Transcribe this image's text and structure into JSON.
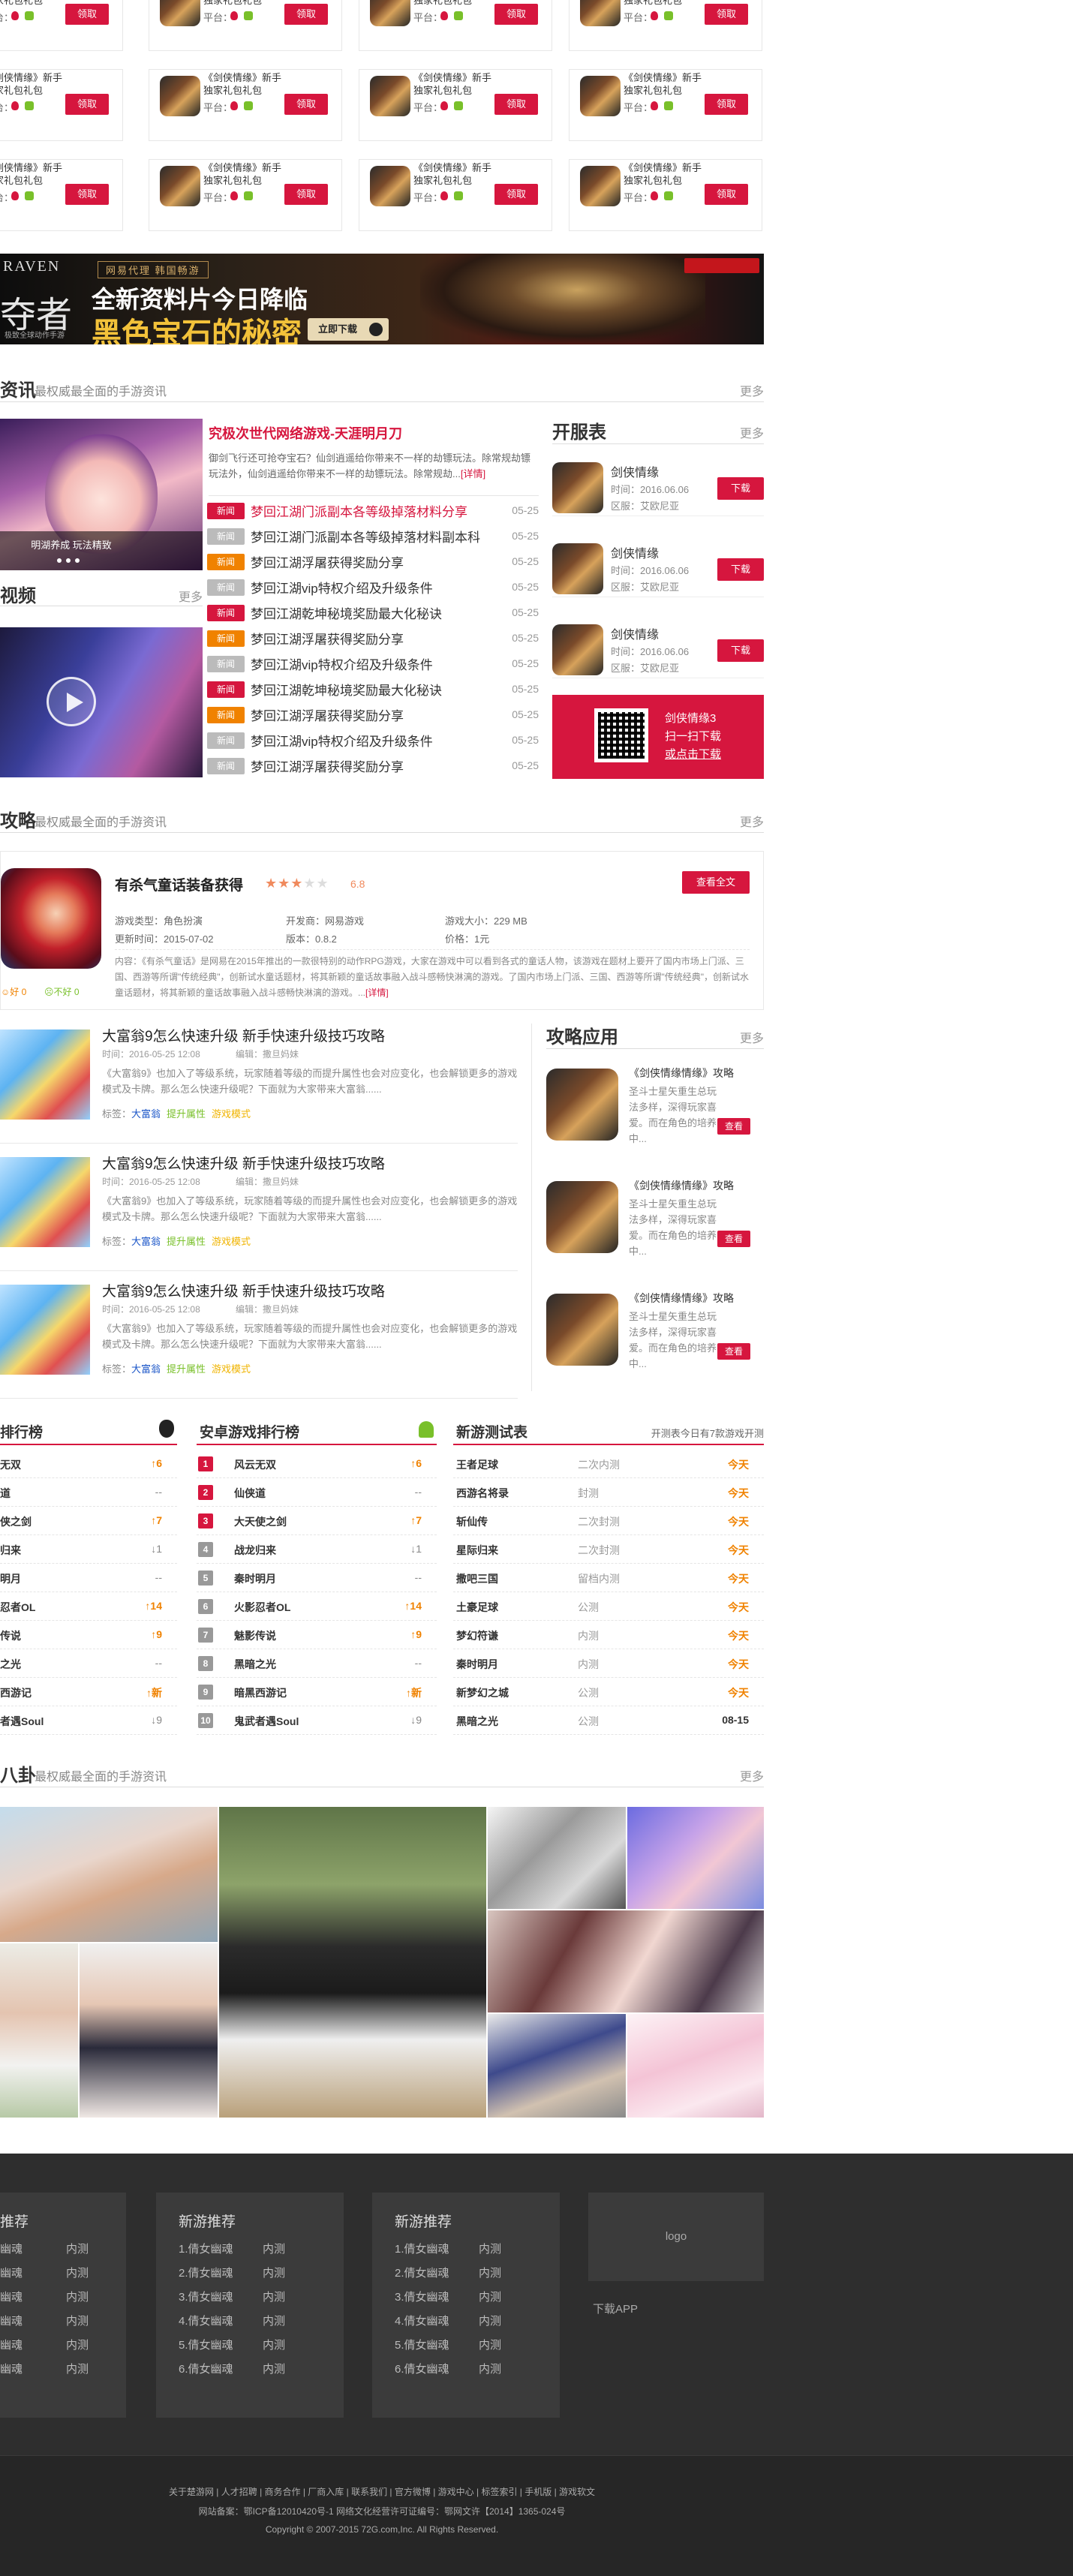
{
  "gift": {
    "title": "《剑侠情缘》新手独家礼包礼包",
    "platform": "平台：",
    "btn": "领取"
  },
  "banner": {
    "brand": "RAVEN",
    "kicker": "网易代理 韩国畅游",
    "left_title": "夺者",
    "left_sub": "极致全球动作手游",
    "headline1": "全新资料片今日降临",
    "headline2": "黑色宝石的秘密",
    "cta": "立即下载"
  },
  "news": {
    "title": "资讯",
    "subtitle": "最权威最全面的手游资讯",
    "more": "更多",
    "image_caption": "明湖养成 玩法精致",
    "headline": "究极次世代网络游戏-天涯明月刀",
    "summary": "御剑飞行还可抢夺宝石？仙剑逍遥给你带来不一样的劫镖玩法。除常规劫镖玩法外，仙剑逍遥给你带来不一样的劫镖玩法。除常规劫...",
    "summary_link": "[详情]",
    "items": [
      {
        "tag": "新闻",
        "title": "梦回江湖门派副本各等级掉落材料分享",
        "date": "05-25"
      },
      {
        "tag": "新闻",
        "title": "梦回江湖门派副本各等级掉落材料副本科",
        "date": "05-25"
      },
      {
        "tag": "新闻",
        "title": "梦回江湖浮屠获得奖励分享",
        "date": "05-25"
      },
      {
        "tag": "新闻",
        "title": "梦回江湖vip特权介绍及升级条件",
        "date": "05-25"
      },
      {
        "tag": "新闻",
        "title": "梦回江湖乾坤秘境奖励最大化秘诀",
        "date": "05-25"
      },
      {
        "tag": "新闻",
        "title": "梦回江湖浮屠获得奖励分享",
        "date": "05-25"
      },
      {
        "tag": "新闻",
        "title": "梦回江湖vip特权介绍及升级条件",
        "date": "05-25"
      },
      {
        "tag": "新闻",
        "title": "梦回江湖乾坤秘境奖励最大化秘诀",
        "date": "05-25"
      },
      {
        "tag": "新闻",
        "title": "梦回江湖浮屠获得奖励分享",
        "date": "05-25"
      },
      {
        "tag": "新闻",
        "title": "梦回江湖vip特权介绍及升级条件",
        "date": "05-25"
      },
      {
        "tag": "新闻",
        "title": "梦回江湖浮屠获得奖励分享",
        "date": "05-25"
      }
    ],
    "tag_colors": [
      "#d6163e",
      "#bbbbbb",
      "#f08200",
      "#bbbbbb",
      "#d6163e",
      "#f08200",
      "#bbbbbb",
      "#d6163e",
      "#f08200",
      "#bbbbbb",
      "#bbbbbb"
    ]
  },
  "video": {
    "title": "视频",
    "more": "更多"
  },
  "server": {
    "title": "开服表",
    "more": "更多",
    "items": [
      {
        "name": "剑侠情缘",
        "time": "时间：2016.06.06",
        "zone": "区服：艾欧尼亚",
        "btn": "下载"
      },
      {
        "name": "剑侠情缘",
        "time": "时间：2016.06.06",
        "zone": "区服：艾欧尼亚",
        "btn": "下载"
      },
      {
        "name": "剑侠情缘",
        "time": "时间：2016.06.06",
        "zone": "区服：艾欧尼亚",
        "btn": "下载"
      }
    ],
    "qr": {
      "line1": "剑侠情缘3",
      "line2": "扫一扫下载",
      "line3": "或点击下载"
    }
  },
  "guide": {
    "title": "攻略",
    "subtitle": "最权威最全面的手游资讯",
    "more": "更多",
    "featured": {
      "name": "有杀气童话装备获得",
      "score": "6.8",
      "btn": "查看全文",
      "type": "游戏类型：角色扮演",
      "dev": "开发商：网易游戏",
      "size": "游戏大小：229 MB",
      "update": "更新时间：2015-07-02",
      "version": "版本：0.8.2",
      "price": "价格：1元",
      "desc": "内容：《有杀气童话》是网易在2015年推出的一款很特别的动作RPG游戏，大家在游戏中可以看到各式的童话人物，该游戏在题材上要开了国内市场上门派、三国、西游等所谓\"传统经典\"，创新试水童话题材，将其新颖的童话故事融入战斗感畅快淋漓的游戏。了国内市场上门派、三国、西游等所谓\"传统经典\"，创新试水童话题材，将其新颖的童话故事融入战斗感畅快淋漓的游戏。...",
      "desc_link": "[详情]",
      "good": "好 0",
      "bad": "不好 0"
    },
    "articles": [
      {
        "title": "大富翁9怎么快速升级 新手快速升级技巧攻略",
        "time": "时间：2016-05-25 12:08",
        "editor": "编辑：撒旦妈妹",
        "summary": "《大富翁9》也加入了等级系统，玩家随着等级的而提升属性也会对应变化，也会解锁更多的游戏模式及卡牌。那么怎么快速升级呢？下面就为大家带来大富翁......",
        "label": "标签：",
        "t1": "大富翁",
        "t2": "提升属性",
        "t3": "游戏模式"
      },
      {
        "title": "大富翁9怎么快速升级 新手快速升级技巧攻略",
        "time": "时间：2016-05-25 12:08",
        "editor": "编辑：撒旦妈妹",
        "summary": "《大富翁9》也加入了等级系统，玩家随着等级的而提升属性也会对应变化，也会解锁更多的游戏模式及卡牌。那么怎么快速升级呢？下面就为大家带来大富翁......",
        "label": "标签：",
        "t1": "大富翁",
        "t2": "提升属性",
        "t3": "游戏模式"
      },
      {
        "title": "大富翁9怎么快速升级 新手快速升级技巧攻略",
        "time": "时间：2016-05-25 12:08",
        "editor": "编辑：撒旦妈妹",
        "summary": "《大富翁9》也加入了等级系统，玩家随着等级的而提升属性也会对应变化，也会解锁更多的游戏模式及卡牌。那么怎么快速升级呢？下面就为大家带来大富翁......",
        "label": "标签：",
        "t1": "大富翁",
        "t2": "提升属性",
        "t3": "游戏模式"
      }
    ],
    "apps_title": "攻略应用",
    "apps_more": "更多",
    "apps": [
      {
        "name": "《剑侠情缘情缘》攻略",
        "desc": "圣斗士星矢重生总玩法多样，深得玩家喜爱。而在角色的培养中...",
        "btn": "查看"
      },
      {
        "name": "《剑侠情缘情缘》攻略",
        "desc": "圣斗士星矢重生总玩法多样，深得玩家喜爱。而在角色的培养中...",
        "btn": "查看"
      },
      {
        "name": "《剑侠情缘情缘》攻略",
        "desc": "圣斗士星矢重生总玩法多样，深得玩家喜爱。而在角色的培养中...",
        "btn": "查看"
      }
    ]
  },
  "ranks": {
    "ios_title": "排行榜",
    "android_title": "安卓游戏排行榜",
    "ios": [
      {
        "name": "无双",
        "change": "↑6"
      },
      {
        "name": "道",
        "change": "--"
      },
      {
        "name": "侠之剑",
        "change": "↑7"
      },
      {
        "name": "归来",
        "change": "↓1"
      },
      {
        "name": "明月",
        "change": "--"
      },
      {
        "name": "忍者OL",
        "change": "↑14"
      },
      {
        "name": "传说",
        "change": "↑9"
      },
      {
        "name": "之光",
        "change": "--"
      },
      {
        "name": "西游记",
        "change": "↑新"
      },
      {
        "name": "者遇Soul",
        "change": "↓9"
      }
    ],
    "android": [
      {
        "num": "1",
        "name": "风云无双",
        "change": "↑6"
      },
      {
        "num": "2",
        "name": "仙侠道",
        "change": "--"
      },
      {
        "num": "3",
        "name": "大天使之剑",
        "change": "↑7"
      },
      {
        "num": "4",
        "name": "战龙归来",
        "change": "↓1"
      },
      {
        "num": "5",
        "name": "秦时明月",
        "change": "--"
      },
      {
        "num": "6",
        "name": "火影忍者OL",
        "change": "↑14"
      },
      {
        "num": "7",
        "name": "魅影传说",
        "change": "↑9"
      },
      {
        "num": "8",
        "name": "黑暗之光",
        "change": "--"
      },
      {
        "num": "9",
        "name": "暗黑西游记",
        "change": "↑新"
      },
      {
        "num": "10",
        "name": "鬼武者遇Soul",
        "change": "↓9"
      }
    ],
    "test_title": "新游测试表",
    "test_note": "开测表今日有7款游戏开测",
    "tests": [
      {
        "name": "王者足球",
        "stage": "二次内测",
        "date": "今天"
      },
      {
        "name": "西游名将录",
        "stage": "封测",
        "date": "今天"
      },
      {
        "name": "斩仙传",
        "stage": "二次封测",
        "date": "今天"
      },
      {
        "name": "星际归来",
        "stage": "二次封测",
        "date": "今天"
      },
      {
        "name": "撒吧三国",
        "stage": "留档内测",
        "date": "今天"
      },
      {
        "name": "土豪足球",
        "stage": "公测",
        "date": "今天"
      },
      {
        "name": "梦幻符谦",
        "stage": "内测",
        "date": "今天"
      },
      {
        "name": "秦时明月",
        "stage": "内测",
        "date": "今天"
      },
      {
        "name": "新梦幻之城",
        "stage": "公测",
        "date": "今天"
      },
      {
        "name": "黑暗之光",
        "stage": "公测",
        "date": "08-15"
      }
    ]
  },
  "gossip": {
    "title": "八卦",
    "subtitle": "最权威最全面的手游资讯",
    "more": "更多"
  },
  "footer": {
    "cols": [
      {
        "title": "新游推荐",
        "items": [
          "1.倩女幽魂",
          "2.倩女幽魂",
          "3.倩女幽魂",
          "4.倩女幽魂",
          "5.倩女幽魂",
          "6.倩女幽魂"
        ],
        "stage": "内测"
      },
      {
        "title": "新游推荐",
        "items": [
          "1.倩女幽魂",
          "2.倩女幽魂",
          "3.倩女幽魂",
          "4.倩女幽魂",
          "5.倩女幽魂",
          "6.倩女幽魂"
        ],
        "stage": "内测"
      },
      {
        "title": "新游推荐",
        "items": [
          "1.倩女幽魂",
          "2.倩女幽魂",
          "3.倩女幽魂",
          "4.倩女幽魂",
          "5.倩女幽魂",
          "6.倩女幽魂"
        ],
        "stage": "内测"
      }
    ],
    "first_col_title": "推荐",
    "first_col_items": [
      "幽魂",
      "幽魂",
      "幽魂",
      "幽魂",
      "幽魂",
      "幽魂"
    ],
    "logo": "logo",
    "app": "下载APP",
    "links": "关于楚游网 | 人才招聘 | 商务合作 | 厂商入库 | 联系我们 | 官方微博 | 游戏中心 | 标签索引 | 手机版 | 游戏软文",
    "icp": "网站备案：鄂ICP备12010420号-1  网络文化经营许可证编号：鄂网文许【2014】1365-024号",
    "copyright": "Copyright © 2007-2015 72G.com,Inc. All Rights Reserved."
  }
}
